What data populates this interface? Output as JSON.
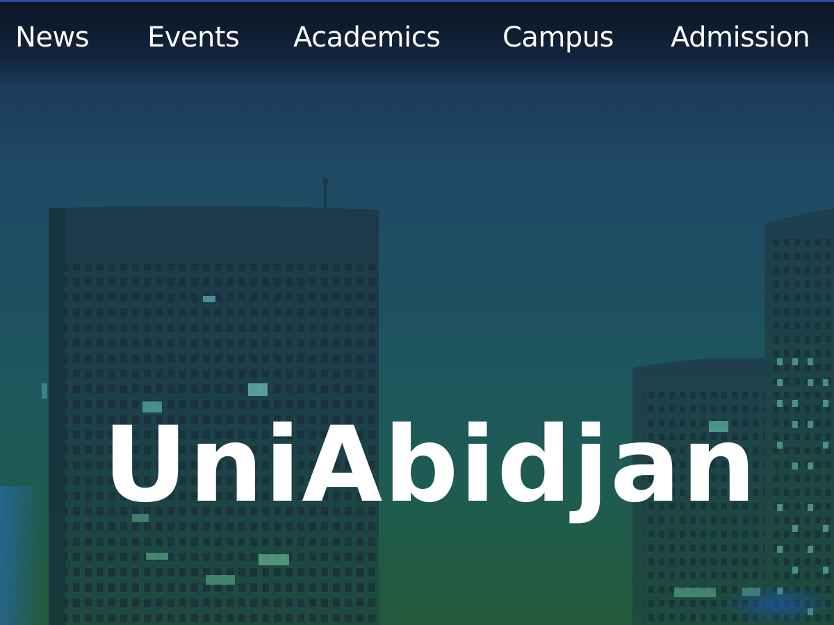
{
  "nav": {
    "items": [
      {
        "label": "News"
      },
      {
        "label": "Events"
      },
      {
        "label": "Academics"
      },
      {
        "label": "Campus"
      },
      {
        "label": "Admission"
      }
    ]
  },
  "hero": {
    "title": "UniAbidjan"
  },
  "colors": {
    "top_rule": "#2a4f9a",
    "text": "#ffffff",
    "sky_top": "#122038",
    "sky_bottom": "#245a3a"
  },
  "background": {
    "image": "city-skyline-image"
  }
}
